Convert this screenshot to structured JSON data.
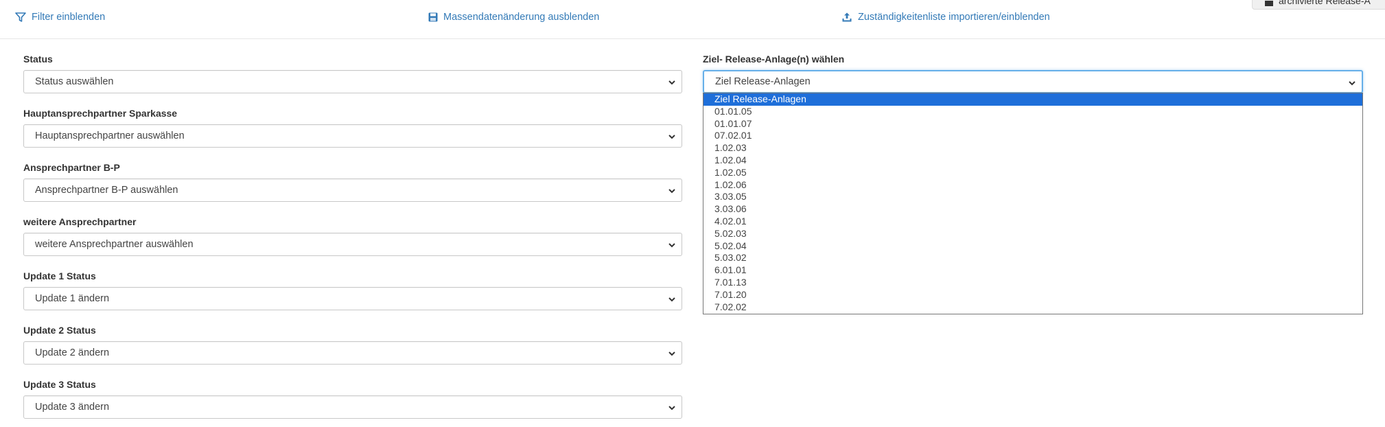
{
  "toolbar": {
    "filter_label": "Filter einblenden",
    "mass_label": "Massendatenänderung ausblenden",
    "import_label": "Zuständigkeitenliste importieren/einblenden",
    "corner_label": "archivierte Release-A"
  },
  "fields": {
    "status": {
      "label": "Status",
      "value": "Status auswählen"
    },
    "hauptansprechpartner": {
      "label": "Hauptansprechpartner Sparkasse",
      "value": "Hauptansprechpartner auswählen"
    },
    "ansprechpartner_bp": {
      "label": "Ansprechpartner B-P",
      "value": "Ansprechpartner B-P auswählen"
    },
    "weitere": {
      "label": "weitere Ansprechpartner",
      "value": "weitere Ansprechpartner auswählen"
    },
    "update1": {
      "label": "Update 1 Status",
      "value": "Update 1 ändern"
    },
    "update2": {
      "label": "Update 2 Status",
      "value": "Update 2 ändern"
    },
    "update3": {
      "label": "Update 3 Status",
      "value": "Update 3 ändern"
    }
  },
  "ziel": {
    "label": "Ziel- Release-Anlage(n) wählen",
    "value": "Ziel Release-Anlagen",
    "options": [
      "Ziel Release-Anlagen",
      "01.01.05",
      "01.01.07",
      "07.02.01",
      "1.02.03",
      "1.02.04",
      "1.02.05",
      "1.02.06",
      "3.03.05",
      "3.03.06",
      "4.02.01",
      "5.02.03",
      "5.02.04",
      "5.03.02",
      "6.01.01",
      "7.01.13",
      "7.01.20",
      "7.02.02"
    ],
    "selected_index": 0
  },
  "colors": {
    "link": "#337ab7",
    "selected_option": "#1e6fd9",
    "focus_border": "#66afe9"
  }
}
